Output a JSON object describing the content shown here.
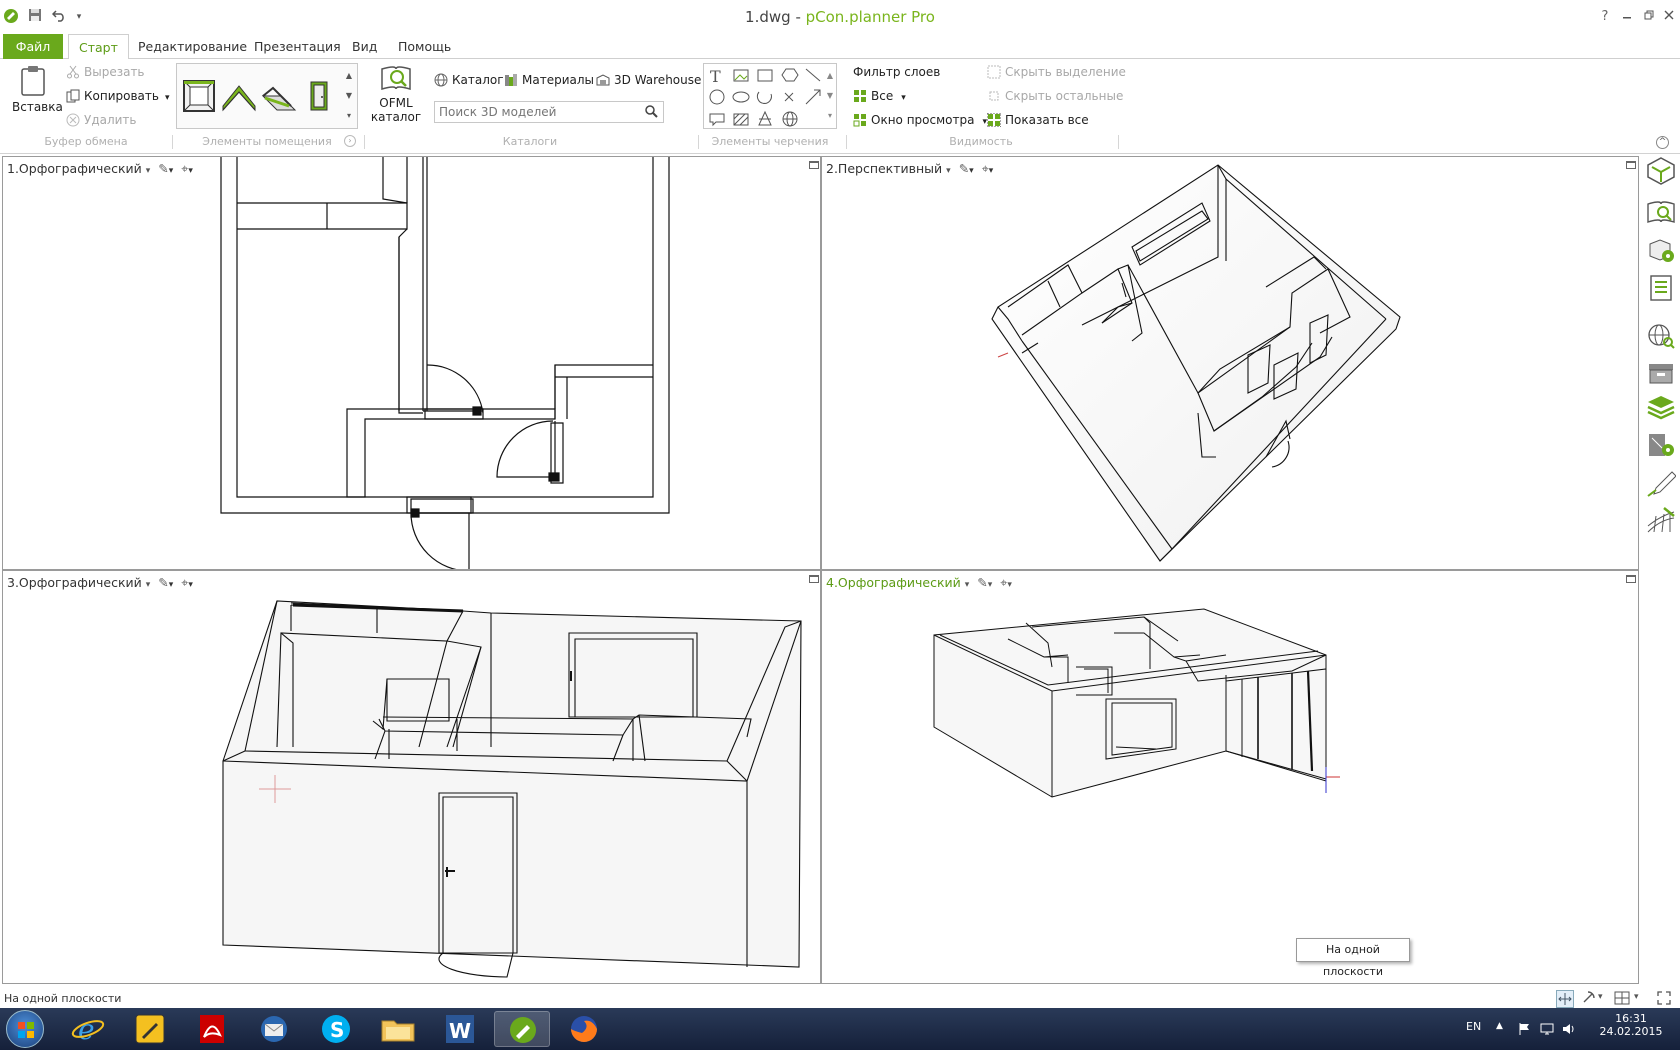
{
  "window": {
    "file": "1.dwg",
    "separator": " - ",
    "app": "pCon.planner Pro",
    "help": "?"
  },
  "tabs": [
    {
      "label": "Файл"
    },
    {
      "label": "Старт"
    },
    {
      "label": "Редактирование"
    },
    {
      "label": "Презентация"
    },
    {
      "label": "Вид"
    },
    {
      "label": "Помощь"
    }
  ],
  "ribbon": {
    "clipboard": {
      "paste": "Вставка",
      "cut": "Вырезать",
      "copy": "Копировать",
      "delete": "Удалить",
      "group": "Буфер обмена"
    },
    "room": {
      "group": "Элементы помещения"
    },
    "catalogs": {
      "ofml_line1": "OFML",
      "ofml_line2": "каталог",
      "catalog": "Каталог",
      "materials": "Материалы",
      "warehouse": "3D Warehouse",
      "search_placeholder": "Поиск 3D моделей",
      "group": "Каталоги"
    },
    "drawing": {
      "group": "Элементы черчения"
    },
    "visibility": {
      "filter": "Фильтр слоев",
      "all": "Все",
      "viewport": "Окно просмотра",
      "hide_selection": "Скрыть выделение",
      "hide_others": "Скрыть остальные",
      "show_all": "Показать все",
      "group": "Видимость"
    }
  },
  "viewports": [
    {
      "title": "1.Орфографический"
    },
    {
      "title": "2.Перспективный"
    },
    {
      "title": "3.Орфографический"
    },
    {
      "title": "4.Орфографический"
    }
  ],
  "tooltip": "На одной плоскости",
  "status": {
    "text": "На одной плоскости"
  },
  "taskbar": {
    "lang": "EN",
    "time": "16:31",
    "date": "24.02.2015"
  },
  "colors": {
    "accent": "#6aa91c",
    "accent_text": "#5c9b15"
  }
}
